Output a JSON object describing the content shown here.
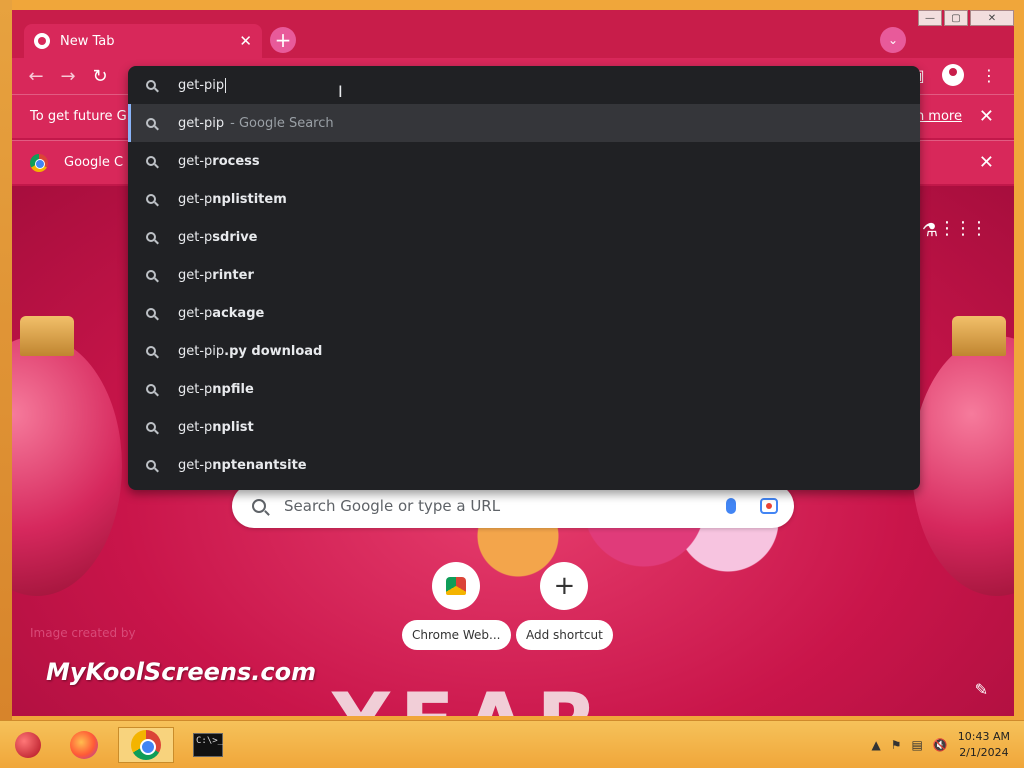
{
  "browser": {
    "tab": {
      "title": "New Tab",
      "close_glyph": "✕"
    },
    "new_tab_glyph": "+",
    "tab_search_glyph": "⌄",
    "window_buttons": {
      "minimize": "—",
      "maximize": "▢",
      "close": "✕"
    },
    "toolbar": {
      "back": "←",
      "forward": "→",
      "reload": "↻"
    }
  },
  "infobars": [
    {
      "text": "To get future G",
      "link": "earn more",
      "close": "✕"
    },
    {
      "text": "Google C",
      "close": "✕"
    }
  ],
  "omnibox": {
    "input_value": "get-pip",
    "suggestions": [
      {
        "prefix": "get-pip",
        "bold": "",
        "secondary": "- Google Search",
        "selected": true
      },
      {
        "prefix": "get-p",
        "bold": "rocess",
        "secondary": ""
      },
      {
        "prefix": "get-p",
        "bold": "nplistitem",
        "secondary": ""
      },
      {
        "prefix": "get-p",
        "bold": "sdrive",
        "secondary": ""
      },
      {
        "prefix": "get-p",
        "bold": "rinter",
        "secondary": ""
      },
      {
        "prefix": "get-p",
        "bold": "ackage",
        "secondary": ""
      },
      {
        "prefix": "get-pip",
        "bold": ".py download",
        "secondary": ""
      },
      {
        "prefix": "get-p",
        "bold": "npfile",
        "secondary": ""
      },
      {
        "prefix": "get-p",
        "bold": "nplist",
        "secondary": ""
      },
      {
        "prefix": "get-p",
        "bold": "nptenantsite",
        "secondary": ""
      }
    ]
  },
  "ntp": {
    "search_placeholder": "Search Google or type a URL",
    "shortcuts": [
      {
        "label": "Chrome Web...",
        "icon": "chrome-web-store-icon"
      },
      {
        "label": "Add shortcut",
        "glyph": "+"
      }
    ],
    "watermark": "MyKoolScreens.com",
    "watermark_small": "Image created by",
    "year_text": "YEAR"
  },
  "taskbar": {
    "apps": [
      "start-ornament",
      "firefox",
      "chrome",
      "command-prompt"
    ],
    "cmd_text": "C:\\>_",
    "clock": {
      "time": "10:43 AM",
      "date": "2/1/2024"
    }
  }
}
